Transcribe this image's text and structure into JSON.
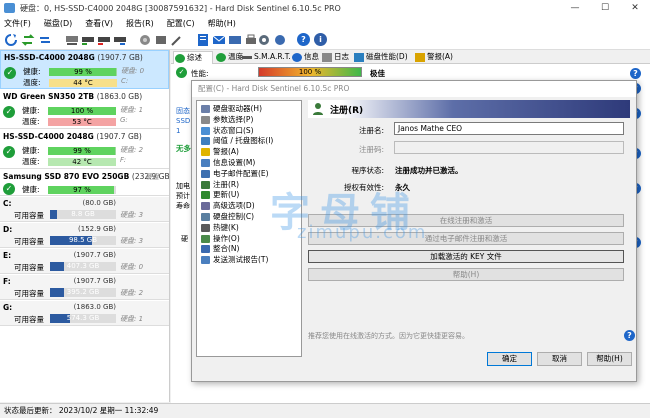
{
  "window": {
    "title": "硬盘：0, HS-SSD-C4000 2048G [30087591632]  -  Hard Disk Sentinel 6.10.5c PRO",
    "minimize": "—",
    "maximize": "☐",
    "close": "✕"
  },
  "menu": [
    "文件(F)",
    "磁盘(D)",
    "查看(V)",
    "报告(R)",
    "配置(C)",
    "帮助(H)"
  ],
  "disks": [
    {
      "name": "HS-SSD-C4000 2048G",
      "size": "(1907.7 GB)",
      "health_label": "健康:",
      "health": "99 %",
      "health_value": 99,
      "temp_label": "温度:",
      "temp": "44 °C",
      "side1": "硬盘: 0",
      "side2": "C:"
    },
    {
      "name": "WD Green SN350 2TB",
      "size": "(1863.0 GB)",
      "health_label": "健康:",
      "health": "100 %",
      "health_value": 100,
      "temp_label": "温度:",
      "temp": "53 °C",
      "side1": "硬盘: 1",
      "side2": "G:"
    },
    {
      "name": "HS-SSD-C4000 2048G",
      "size": "(1907.7 GB)",
      "health_label": "健康:",
      "health": "99 %",
      "health_value": 99,
      "temp_label": "温度:",
      "temp": "42 °C",
      "side1": "硬盘: 2",
      "side2": "F:"
    },
    {
      "name": "Samsung SSD 870 EVO 250GB",
      "size": "(232.9 GB)",
      "health_label": "健康:",
      "health": "97 %",
      "health_value": 97,
      "temp_label": "",
      "temp": "",
      "side1": "硬盘",
      "side2": ""
    }
  ],
  "volumes": [
    {
      "name": "C:",
      "size": "(80.0 GB)",
      "free_label": "可用容量",
      "free": "8.8 GB",
      "free_fraction": 0.11,
      "side": "硬盘: 3"
    },
    {
      "name": "D:",
      "size": "(152.9 GB)",
      "free_label": "可用容量",
      "free": "98.5 GB",
      "free_fraction": 0.64,
      "side": "硬盘: 3"
    },
    {
      "name": "E:",
      "size": "(1907.7 GB)",
      "free_label": "可用容量",
      "free": "407.3 GB",
      "free_fraction": 0.21,
      "side": "硬盘: 0"
    },
    {
      "name": "F:",
      "size": "(1907.7 GB)",
      "free_label": "可用容量",
      "free": "395.2 GB",
      "free_fraction": 0.21,
      "side": "硬盘: 2"
    },
    {
      "name": "G:",
      "size": "(1863.0 GB)",
      "free_label": "可用容量",
      "free": "574.3 GB",
      "free_fraction": 0.31,
      "side": "硬盘: 1"
    }
  ],
  "status": "状态最后更新：  2023/10/2 星期一 11:32:49",
  "tabs": [
    "综述",
    "温度",
    "S.M.A.R.T.",
    "信息",
    "日志",
    "磁盘性能(D)",
    "警报(A)"
  ],
  "overview": {
    "perf_label": "性能:",
    "perf_value": "100 %",
    "perf_text": "极佳",
    "health_label": "健康:",
    "health_text": "极佳"
  },
  "dialog": {
    "title": "配置(C)  -  Hard Disk Sentinel 6.10.5c PRO",
    "tree": [
      {
        "label": "硬盘驱动器(H)",
        "color": "#6b7fa8"
      },
      {
        "label": "参数选择(P)",
        "color": "#8a8a8a"
      },
      {
        "label": "状态窗口(S)",
        "color": "#4a8fd4"
      },
      {
        "label": "阈值 / 托盘图标(I)",
        "color": "#3f7fbf"
      },
      {
        "label": "警报(A)",
        "color": "#e0b400"
      },
      {
        "label": "信息设置(M)",
        "color": "#4a7fbf"
      },
      {
        "label": "电子邮件配置(E)",
        "color": "#3d6fb0"
      },
      {
        "label": "注册(R)",
        "color": "#3a7a3a"
      },
      {
        "label": "更新(U)",
        "color": "#2f8a2f"
      },
      {
        "label": "高级选项(D)",
        "color": "#6a6a9a"
      },
      {
        "label": "硬盘控制(C)",
        "color": "#5a7fa0"
      },
      {
        "label": "热键(K)",
        "color": "#5a5a5a"
      },
      {
        "label": "操作(O)",
        "color": "#4a8a4a"
      },
      {
        "label": "整合(N)",
        "color": "#3a6ab0"
      },
      {
        "label": "发送测试报告(T)",
        "color": "#4a7fbf"
      }
    ],
    "header": "注册(R)",
    "reg_name_label": "注册名:",
    "reg_name": "Janos Mathe CEO",
    "reg_code_label": "注册码:",
    "reg_code": "",
    "program_status_label": "程序状态:",
    "program_status": "注册成功并已激活。",
    "license_label": "授权有效性:",
    "license": "永久",
    "btn_online": "在线注册和激活",
    "btn_email": "通过电子邮件注册和激活",
    "btn_load_key": "加载激活的 KEY 文件",
    "btn_help_inner": "帮助(H)",
    "hint": "推荐您使用在线激活的方式。因为它更快捷更容易。",
    "ok": "确定",
    "cancel": "取消",
    "help": "帮助(H)"
  },
  "watermark": {
    "cn": "字母铺",
    "en": "zimupu.com"
  },
  "fragments": {
    "left_col": [
      "固态",
      "SSD",
      "1",
      "无多",
      "加电",
      "预计",
      "寿命",
      "硬"
    ]
  }
}
